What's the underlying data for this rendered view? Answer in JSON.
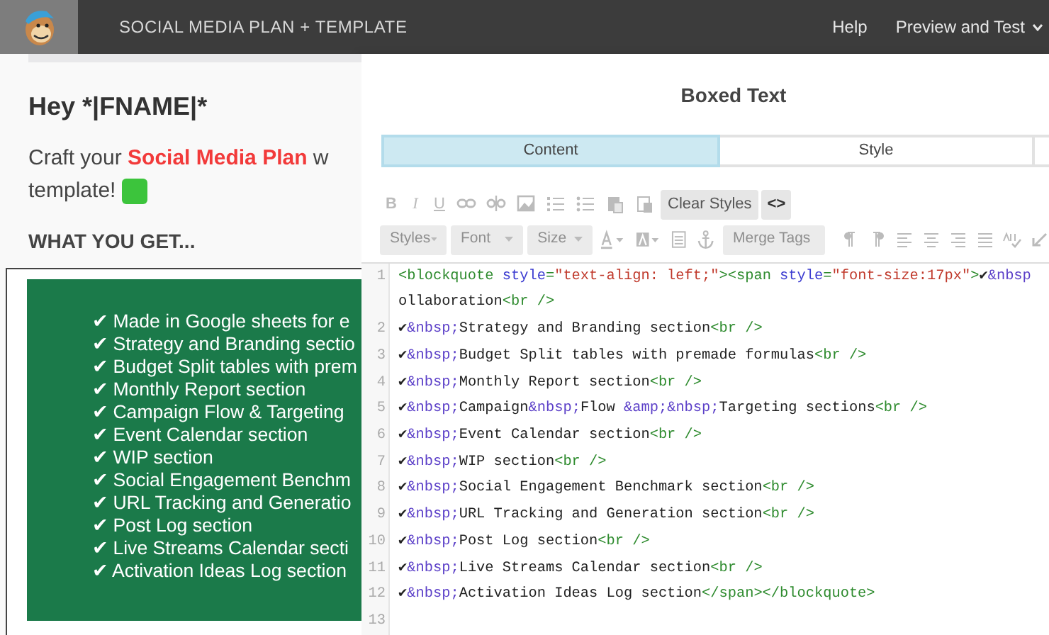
{
  "topbar": {
    "title": "SOCIAL MEDIA PLAN + TEMPLATE",
    "links": [
      {
        "label": "Help",
        "dropdown": false
      },
      {
        "label": "Preview and Test",
        "dropdown": true
      }
    ]
  },
  "preview": {
    "greeting": "Hey *|FNAME|*",
    "intro": [
      {
        "text": "Craft your ",
        "kind": "plain"
      },
      {
        "text": "Social Media Plan",
        "kind": "link"
      },
      {
        "text": " w",
        "kind": "plain"
      }
    ],
    "intro_2": "template!",
    "heading": "WHAT YOU GET...",
    "box_lines": [
      "✔ Made in Google sheets for e",
      "✔ Strategy and Branding sectio",
      "✔ Budget Split tables with prem",
      "✔ Monthly Report section",
      "✔ Campaign Flow & Targeting",
      "✔ Event Calendar section",
      "✔ WIP section",
      "✔ Social Engagement Benchm",
      "✔ URL Tracking and Generatio",
      "✔ Post Log section",
      "✔ Live Streams Calendar secti",
      "✔ Activation Ideas Log section"
    ]
  },
  "editor": {
    "title": "Boxed Text",
    "tabs": [
      {
        "label": "Content",
        "selected": true
      },
      {
        "label": "Style",
        "selected": false
      }
    ],
    "toolbar_1": {
      "letters": [
        "B",
        "I",
        "U"
      ],
      "buttons": [
        {
          "label": "Clear Styles",
          "kind": "text"
        },
        {
          "label": "<>",
          "kind": "code"
        }
      ]
    },
    "toolbar_2": {
      "dropdowns": [
        {
          "label": "Styles",
          "disabled": true
        },
        {
          "label": "Font",
          "disabled": true
        },
        {
          "label": "Size",
          "disabled": true
        }
      ],
      "merge": {
        "label": "Merge Tags",
        "disabled": true
      }
    },
    "code_lines": [
      {
        "number": "1",
        "rows": [
          [
            {
              "kind": "tag",
              "text": "<blockquote "
            },
            {
              "kind": "attr",
              "text": "style"
            },
            {
              "kind": "tag",
              "text": "="
            },
            {
              "kind": "value",
              "text": "\"text-align: left;\""
            },
            {
              "kind": "tag",
              "text": "><span "
            },
            {
              "kind": "attr",
              "text": "style"
            },
            {
              "kind": "tag",
              "text": "="
            },
            {
              "kind": "value",
              "text": "\"font-size:17px\""
            },
            {
              "kind": "tag",
              "text": ">"
            },
            {
              "kind": "text",
              "text": "✔"
            },
            {
              "kind": "entity",
              "text": "&nbsp"
            }
          ],
          [
            {
              "kind": "text",
              "text": "ollaboration"
            },
            {
              "kind": "tag",
              "text": "<br />"
            }
          ]
        ]
      },
      {
        "number": "2",
        "rows": [
          [
            {
              "kind": "text",
              "text": "✔"
            },
            {
              "kind": "entity",
              "text": "&nbsp;"
            },
            {
              "kind": "text",
              "text": "Strategy and Branding section"
            },
            {
              "kind": "tag",
              "text": "<br />"
            }
          ]
        ]
      },
      {
        "number": "3",
        "rows": [
          [
            {
              "kind": "text",
              "text": "✔"
            },
            {
              "kind": "entity",
              "text": "&nbsp;"
            },
            {
              "kind": "text",
              "text": "Budget Split tables with premade formulas"
            },
            {
              "kind": "tag",
              "text": "<br />"
            }
          ]
        ]
      },
      {
        "number": "4",
        "rows": [
          [
            {
              "kind": "text",
              "text": "✔"
            },
            {
              "kind": "entity",
              "text": "&nbsp;"
            },
            {
              "kind": "text",
              "text": "Monthly Report section"
            },
            {
              "kind": "tag",
              "text": "<br />"
            }
          ]
        ]
      },
      {
        "number": "5",
        "rows": [
          [
            {
              "kind": "text",
              "text": "✔"
            },
            {
              "kind": "entity",
              "text": "&nbsp;"
            },
            {
              "kind": "text",
              "text": "Campaign"
            },
            {
              "kind": "entity",
              "text": "&nbsp;"
            },
            {
              "kind": "text",
              "text": "Flow "
            },
            {
              "kind": "entity",
              "text": "&amp;&nbsp;"
            },
            {
              "kind": "text",
              "text": "Targeting sections"
            },
            {
              "kind": "tag",
              "text": "<br />"
            }
          ]
        ]
      },
      {
        "number": "6",
        "rows": [
          [
            {
              "kind": "text",
              "text": "✔"
            },
            {
              "kind": "entity",
              "text": "&nbsp;"
            },
            {
              "kind": "text",
              "text": "Event Calendar section"
            },
            {
              "kind": "tag",
              "text": "<br />"
            }
          ]
        ]
      },
      {
        "number": "7",
        "rows": [
          [
            {
              "kind": "text",
              "text": "✔"
            },
            {
              "kind": "entity",
              "text": "&nbsp;"
            },
            {
              "kind": "text",
              "text": "WIP section"
            },
            {
              "kind": "tag",
              "text": "<br />"
            }
          ]
        ]
      },
      {
        "number": "8",
        "rows": [
          [
            {
              "kind": "text",
              "text": "✔"
            },
            {
              "kind": "entity",
              "text": "&nbsp;"
            },
            {
              "kind": "text",
              "text": "Social Engagement Benchmark section"
            },
            {
              "kind": "tag",
              "text": "<br />"
            }
          ]
        ]
      },
      {
        "number": "9",
        "rows": [
          [
            {
              "kind": "text",
              "text": "✔"
            },
            {
              "kind": "entity",
              "text": "&nbsp;"
            },
            {
              "kind": "text",
              "text": "URL Tracking and Generation section"
            },
            {
              "kind": "tag",
              "text": "<br />"
            }
          ]
        ]
      },
      {
        "number": "10",
        "rows": [
          [
            {
              "kind": "text",
              "text": "✔"
            },
            {
              "kind": "entity",
              "text": "&nbsp;"
            },
            {
              "kind": "text",
              "text": "Post Log section"
            },
            {
              "kind": "tag",
              "text": "<br />"
            }
          ]
        ]
      },
      {
        "number": "11",
        "rows": [
          [
            {
              "kind": "text",
              "text": "✔"
            },
            {
              "kind": "entity",
              "text": "&nbsp;"
            },
            {
              "kind": "text",
              "text": "Live Streams Calendar section"
            },
            {
              "kind": "tag",
              "text": "<br />"
            }
          ]
        ]
      },
      {
        "number": "12",
        "rows": [
          [
            {
              "kind": "text",
              "text": "✔"
            },
            {
              "kind": "entity",
              "text": "&nbsp;"
            },
            {
              "kind": "text",
              "text": "Activation Ideas Log section"
            },
            {
              "kind": "tag",
              "text": "</span></blockquote>"
            }
          ]
        ]
      },
      {
        "number": "13",
        "rows": [
          []
        ]
      }
    ]
  }
}
